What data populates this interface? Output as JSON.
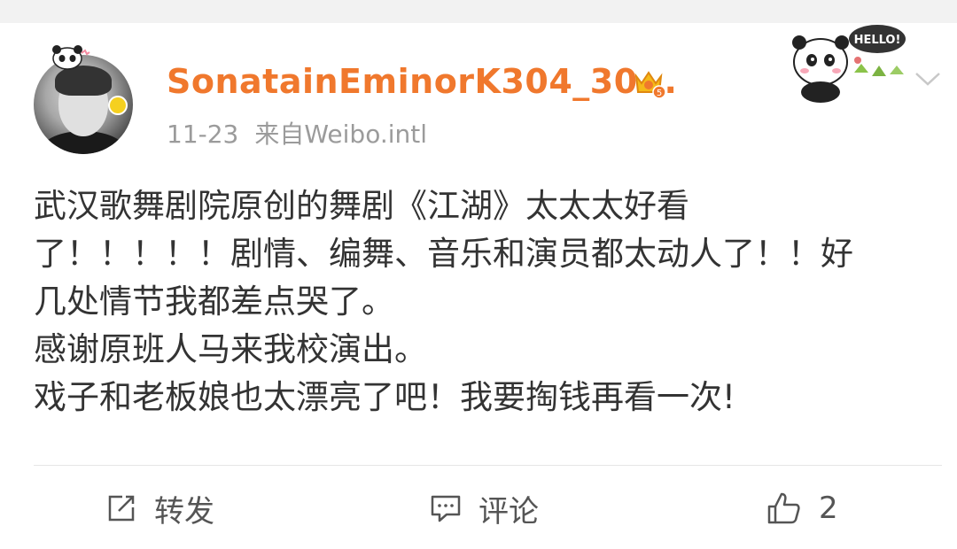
{
  "post": {
    "username": "SonatainEminorK304_30...",
    "time": "11-23",
    "source": "来自Weibo.intl",
    "sticker_text": "HELLO!",
    "badge_level": "5",
    "lines": [
      "武汉歌舞剧院原创的舞剧《江湖》太太太好看",
      "了！！！！！剧情、编舞、音乐和演员都太动人了！！好",
      "几处情节我都差点哭了。",
      "感谢原班人马来我校演出。",
      "戏子和老板娘也太漂亮了吧！我要掏钱再看一次!"
    ]
  },
  "actions": {
    "repost_label": "转发",
    "comment_label": "评论",
    "like_count": "2"
  },
  "colors": {
    "username": "#f0782d",
    "meta": "#9b9b9b",
    "text": "#333333",
    "icon": "#555555"
  }
}
